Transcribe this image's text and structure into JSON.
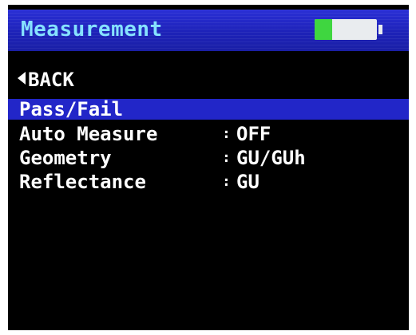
{
  "header": {
    "title": "Measurement",
    "battery_level": 0.28
  },
  "back_label": "BACK",
  "menu": {
    "items": [
      {
        "label": "Pass/Fail",
        "value": "",
        "selected": true
      },
      {
        "label": "Auto Measure",
        "value": "OFF"
      },
      {
        "label": "Geometry",
        "value": "GU/GUh"
      },
      {
        "label": "Reflectance",
        "value": "GU"
      }
    ],
    "separator": ":"
  },
  "colors": {
    "title_bar": "#1d22b8",
    "title_text": "#86e2ff",
    "highlight": "#2226c8",
    "battery_fill": "#3fd640",
    "background": "#000000"
  }
}
